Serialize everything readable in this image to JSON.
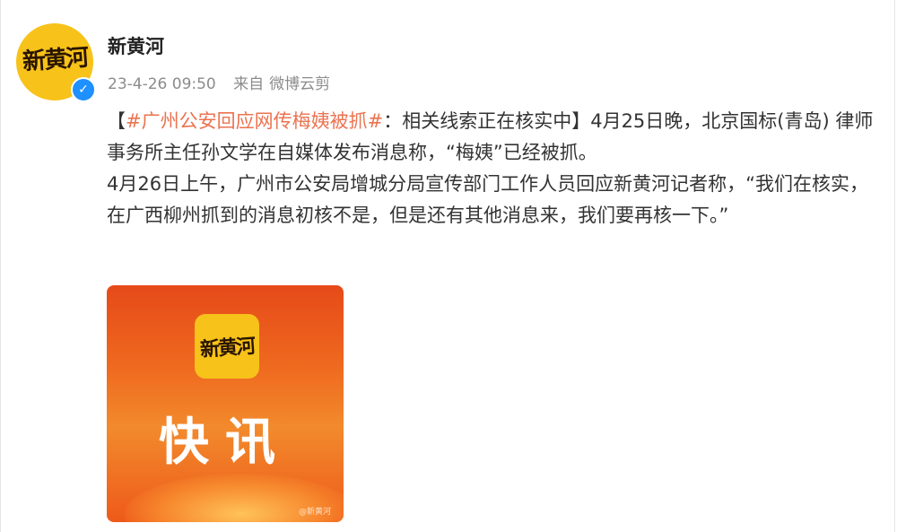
{
  "user": {
    "name": "新黄河",
    "avatar_text": "新黄河",
    "verified_icon": "verified-icon"
  },
  "meta": {
    "timestamp": "23-4-26 09:50",
    "source_label": "来自",
    "source": "微博云剪"
  },
  "post": {
    "bracket_open": "【",
    "topic": "#广州公安回应网传梅姨被抓#",
    "headline_rest": "：相关线索正在核实中】4月25日晚，北京国标(青岛) 律师事务所主任孙文学在自媒体发布消息称，“梅姨”已经被抓。",
    "paragraph2": "4月26日上午，广州市公安局增城分局宣传部门工作人员回应新黄河记者称，“我们在核实，在广西柳州抓到的消息初核不是，但是还有其他消息来，我们要再核一下。”"
  },
  "image": {
    "logo_text": "新黄河",
    "title": "快讯",
    "watermark": "@新黄河"
  },
  "colors": {
    "topic": "#eb7350",
    "avatar_bg": "#f7c21a",
    "verified": "#1e90ff"
  }
}
